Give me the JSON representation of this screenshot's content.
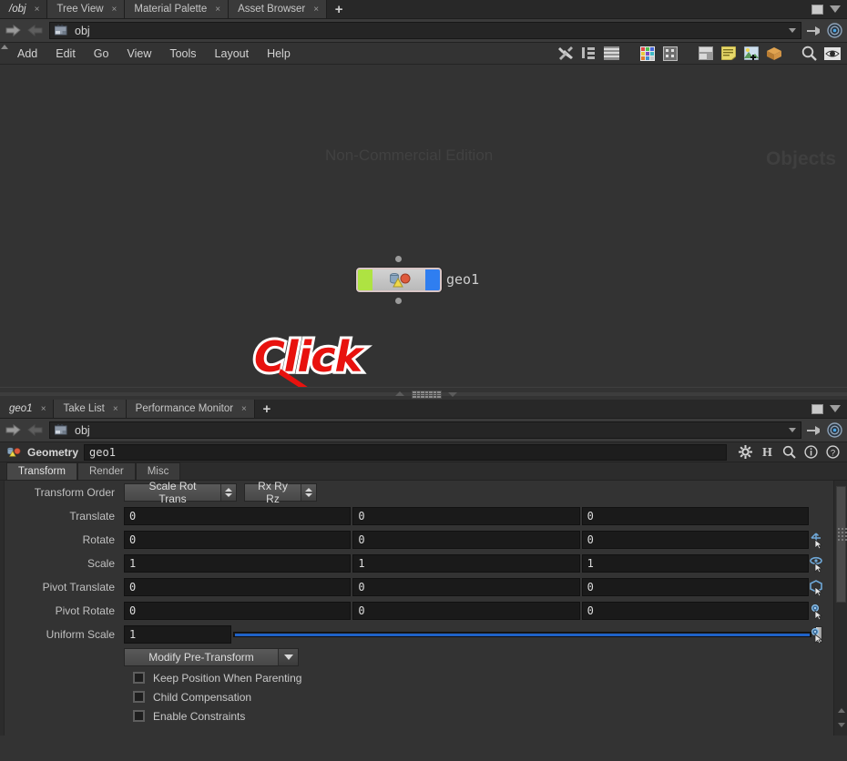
{
  "network_pane": {
    "tabs": [
      {
        "label": "/obj",
        "active": true,
        "close": "×"
      },
      {
        "label": "Tree View",
        "active": false,
        "close": "×"
      },
      {
        "label": "Material Palette",
        "active": false,
        "close": "×"
      },
      {
        "label": "Asset Browser",
        "active": false,
        "close": "×"
      }
    ],
    "add_tab": "+",
    "path": "obj",
    "menu": [
      "Add",
      "Edit",
      "Go",
      "View",
      "Tools",
      "Layout",
      "Help"
    ],
    "watermark": "Non-Commercial Edition",
    "context_label": "Objects",
    "node": {
      "name": "geo1",
      "flag_left_color": "#aee342",
      "flag_right_color": "#2f7ef0",
      "body_color": "#c8c8c8"
    },
    "annotation": {
      "text": "Click",
      "color": "#e8120e",
      "outline": "#ffffff"
    },
    "toolbar_icons": [
      "tools-icon",
      "network-tree-icon",
      "list-icon",
      "color-palette-icon",
      "grid-dots-icon",
      "layout-panes-icon",
      "notes-icon",
      "image-add-icon",
      "box-icon",
      "search-icon",
      "eye-icon"
    ]
  },
  "parameter_pane": {
    "tabs": [
      {
        "label": "geo1",
        "active": true,
        "close": "×"
      },
      {
        "label": "Take List",
        "active": false,
        "close": "×"
      },
      {
        "label": "Performance Monitor",
        "active": false,
        "close": "×"
      }
    ],
    "add_tab": "+",
    "path": "obj",
    "header": {
      "node_type": "Geometry",
      "node_name": "geo1",
      "icons": [
        "gear-icon",
        "houdini-h-icon",
        "search-icon",
        "info-icon",
        "help-icon"
      ]
    },
    "tabs_row": [
      {
        "label": "Transform",
        "active": true
      },
      {
        "label": "Render",
        "active": false
      },
      {
        "label": "Misc",
        "active": false
      }
    ],
    "transform_order": {
      "label": "Transform Order",
      "srt_value": "Scale Rot Trans",
      "rotate_value": "Rx Ry Rz"
    },
    "rows": [
      {
        "label": "Translate",
        "values": [
          "0",
          "0",
          "0"
        ],
        "handle_icon": "translate-handle-icon"
      },
      {
        "label": "Rotate",
        "values": [
          "0",
          "0",
          "0"
        ],
        "handle_icon": "rotate-handle-icon"
      },
      {
        "label": "Scale",
        "values": [
          "1",
          "1",
          "1"
        ],
        "handle_icon": "scale-handle-icon"
      },
      {
        "label": "Pivot Translate",
        "values": [
          "0",
          "0",
          "0"
        ],
        "handle_icon": "pivot-translate-handle-icon"
      },
      {
        "label": "Pivot Rotate",
        "values": [
          "0",
          "0",
          "0"
        ],
        "handle_icon": "pivot-rotate-handle-icon"
      }
    ],
    "uniform_scale": {
      "label": "Uniform Scale",
      "value": "1",
      "slider_color": "#1f62c8"
    },
    "pre_transform": {
      "label": "Modify Pre-Transform"
    },
    "checkboxes": [
      {
        "label": "Keep Position When Parenting",
        "checked": false
      },
      {
        "label": "Child Compensation",
        "checked": false
      },
      {
        "label": "Enable Constraints",
        "checked": false
      }
    ]
  },
  "colors": {
    "bg": "#333333",
    "panel": "#2e2e2e",
    "field": "#1a1a1a",
    "accent": "#1f62c8",
    "annotation_red": "#e8120e"
  }
}
